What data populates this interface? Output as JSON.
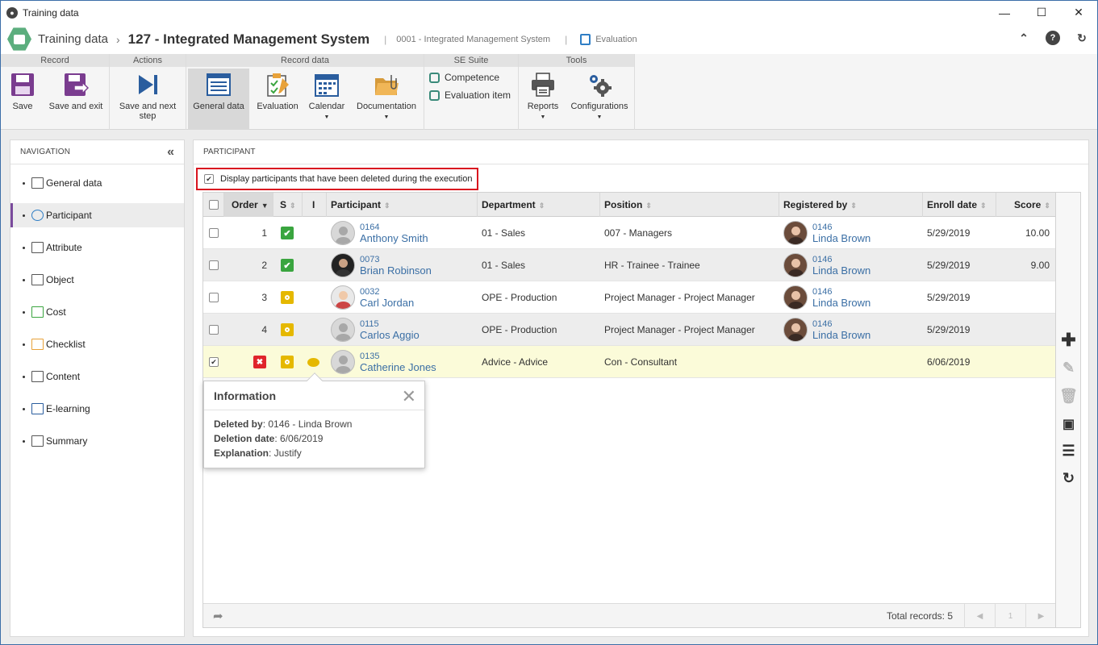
{
  "window": {
    "title": "Training data"
  },
  "header": {
    "crumb_root": "Training data",
    "crumb_sep": "›",
    "record_title": "127 - Integrated Management System",
    "sub_record": "0001 - Integrated Management System",
    "sub_tab": "Evaluation"
  },
  "ribbon": {
    "groups": {
      "record": "Record",
      "actions": "Actions",
      "record_data": "Record data",
      "se_suite": "SE Suite",
      "tools": "Tools"
    },
    "buttons": {
      "save": "Save",
      "save_exit": "Save and exit",
      "save_next_1": "Save and next",
      "save_next_2": "step",
      "general_data": "General data",
      "evaluation": "Evaluation",
      "calendar": "Calendar",
      "documentation": "Documentation",
      "competence": "Competence",
      "evaluation_item": "Evaluation item",
      "reports": "Reports",
      "configurations": "Configurations"
    }
  },
  "navigation": {
    "title": "NAVIGATION",
    "items": [
      {
        "label": "General data",
        "icon": "form-icon"
      },
      {
        "label": "Participant",
        "icon": "users-icon"
      },
      {
        "label": "Attribute",
        "icon": "attribute-icon"
      },
      {
        "label": "Object",
        "icon": "object-icon"
      },
      {
        "label": "Cost",
        "icon": "cost-icon"
      },
      {
        "label": "Checklist",
        "icon": "checklist-icon"
      },
      {
        "label": "Content",
        "icon": "content-icon"
      },
      {
        "label": "E-learning",
        "icon": "elearning-icon"
      },
      {
        "label": "Summary",
        "icon": "summary-icon"
      }
    ],
    "selected": "Participant"
  },
  "participant": {
    "section_title": "PARTICIPANT",
    "deleted_toggle_label": "Display participants that have been deleted during the execution",
    "deleted_toggle_checked": true,
    "columns": {
      "order": "Order",
      "s": "S",
      "i": "I",
      "participant": "Participant",
      "department": "Department",
      "position": "Position",
      "registered_by": "Registered by",
      "enroll_date": "Enroll date",
      "score": "Score"
    },
    "rows": [
      {
        "order": "1",
        "status": "ok",
        "code": "0164",
        "name": "Anthony Smith",
        "department": "01 - Sales",
        "position": "007 - Managers",
        "reg_code": "0146",
        "reg_name": "Linda Brown",
        "enroll": "5/29/2019",
        "score": "10.00"
      },
      {
        "order": "2",
        "status": "ok",
        "code": "0073",
        "name": "Brian Robinson",
        "department": "01 - Sales",
        "position": "HR - Trainee - Trainee",
        "reg_code": "0146",
        "reg_name": "Linda Brown",
        "enroll": "5/29/2019",
        "score": "9.00"
      },
      {
        "order": "3",
        "status": "pending",
        "code": "0032",
        "name": "Carl Jordan",
        "department": "OPE - Production",
        "position": "Project Manager - Project Manager",
        "reg_code": "0146",
        "reg_name": "Linda Brown",
        "enroll": "5/29/2019",
        "score": ""
      },
      {
        "order": "4",
        "status": "pending",
        "code": "0115",
        "name": "Carlos Aggio",
        "department": "OPE - Production",
        "position": "Project Manager - Project Manager",
        "reg_code": "0146",
        "reg_name": "Linda Brown",
        "enroll": "5/29/2019",
        "score": ""
      },
      {
        "order": "",
        "status": "pending",
        "deleted": true,
        "code": "0135",
        "name": "Catherine Jones",
        "department": "Advice - Advice",
        "position": "Con - Consultant",
        "reg_code": "",
        "reg_name": "",
        "enroll": "6/06/2019",
        "score": ""
      }
    ],
    "info_popup": {
      "title": "Information",
      "deleted_by_label": "Deleted by",
      "deleted_by": ": 0146 - Linda Brown",
      "deletion_date_label": "Deletion date",
      "deletion_date": ": 6/06/2019",
      "explanation_label": "Explanation",
      "explanation": ": Justify"
    },
    "footer": {
      "total": "Total records: 5",
      "page": "1"
    }
  }
}
